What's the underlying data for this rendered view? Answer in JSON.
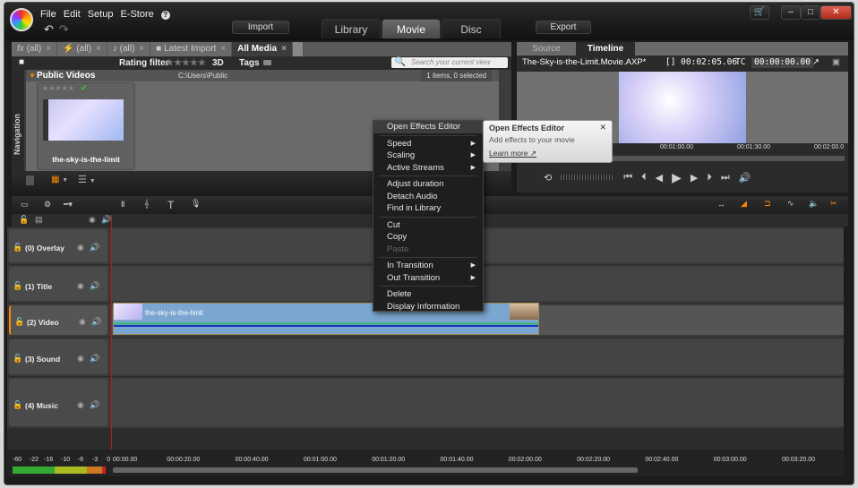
{
  "app": {
    "menu": [
      "File",
      "Edit",
      "Setup",
      "E-Store",
      "?"
    ],
    "import_label": "Import",
    "export_label": "Export",
    "main_tabs": [
      {
        "label": "Library"
      },
      {
        "label": "Movie",
        "active": true
      },
      {
        "label": "Disc"
      }
    ],
    "icons": {
      "undo": "undo-icon",
      "redo": "redo-icon",
      "cart": "cart-icon"
    },
    "window_controls": {
      "minimize": "–",
      "maximize": "□",
      "close": "✕"
    }
  },
  "library": {
    "tabs": [
      {
        "icon": "fx",
        "label": "(all)"
      },
      {
        "icon": "⚡",
        "label": "(all)"
      },
      {
        "icon": "♪",
        "label": "(all)"
      },
      {
        "icon": "■",
        "label": "Latest Import"
      },
      {
        "icon": "",
        "label": "All Media",
        "active": true
      }
    ],
    "close_glyph": "×",
    "rating_filter_label": "Rating filter",
    "rating_stars": "★★★★★",
    "three_d_label": "3D",
    "tags_label": "Tags",
    "search_placeholder": "Search your current view",
    "navigation_label": "Navigation",
    "folder": {
      "name": "Public Videos",
      "path": "C:\\Users\\Public",
      "count": "1 items, 0 selected"
    },
    "item": {
      "name": "the-sky-is-the-limit",
      "stars": "★★★★★",
      "check": "✔"
    }
  },
  "preview": {
    "tabs": [
      {
        "label": "Source"
      },
      {
        "label": "Timeline",
        "active": true
      }
    ],
    "project_name": "The-Sky-is-the-Limit.Movie.AXP*",
    "duration": "[] 00:02:05.06",
    "tc_label": "TC",
    "timecode": "00:00:00.00",
    "ruler_labels": [
      "00:01:00.00",
      "00:01:30.00",
      "00:02:00.0"
    ],
    "transport": [
      "⟲",
      "⏮",
      "⏮",
      "◀",
      "▶",
      "▶",
      "⏭",
      "⏭",
      "◁)"
    ]
  },
  "context_menu": {
    "groups": [
      [
        {
          "label": "Open Effects Editor",
          "highlight": true
        }
      ],
      [
        {
          "label": "Speed",
          "sub": true
        },
        {
          "label": "Scaling",
          "sub": true
        },
        {
          "label": "Active Streams",
          "sub": true
        }
      ],
      [
        {
          "label": "Adjust duration"
        },
        {
          "label": "Detach Audio"
        },
        {
          "label": "Find in Library"
        }
      ],
      [
        {
          "label": "Cut"
        },
        {
          "label": "Copy"
        },
        {
          "label": "Paste",
          "disabled": true
        }
      ],
      [
        {
          "label": "In Transition",
          "sub": true
        },
        {
          "label": "Out Transition",
          "sub": true
        }
      ],
      [
        {
          "label": "Delete"
        },
        {
          "label": "Display Information"
        }
      ]
    ]
  },
  "tooltip": {
    "title": "Open Effects Editor",
    "body": "Add effects to your movie",
    "link": "Learn more",
    "close": "✕"
  },
  "timeline": {
    "tracks": [
      {
        "label": "(0) Overlay"
      },
      {
        "label": "(1) Title"
      },
      {
        "label": "(2) Video",
        "selected": true
      },
      {
        "label": "(3) Sound"
      },
      {
        "label": "(4) Music"
      }
    ],
    "clip": {
      "name": "the-sky-is-the-limit"
    },
    "ruler_labels": [
      "00:00.00",
      "00:00:20.00",
      "00:00:40.00",
      "00:01:00.00",
      "00:01:20.00",
      "00:01:40.00",
      "00:02:00.00",
      "00:02:20.00",
      "00:02:40.00",
      "00:03:00.00",
      "00:03:20.00"
    ],
    "meter_labels": [
      "-60",
      "-22",
      "-16",
      "-10",
      "-6",
      "-3",
      "0"
    ]
  }
}
